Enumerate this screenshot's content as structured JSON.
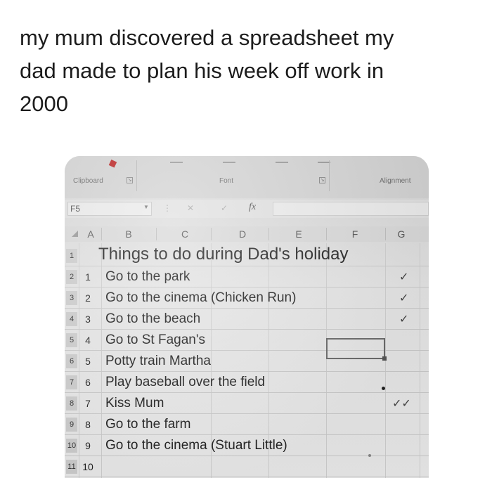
{
  "caption": "my mum discovered a spreadsheet my\ndad made to plan his week off work in\n2000",
  "ribbon": {
    "clipboard_label": "Clipboard",
    "font_label": "Font",
    "alignment_label": "Alignment"
  },
  "formula_bar": {
    "name_box": "F5",
    "fx_label": "fx",
    "formula": ""
  },
  "columns": [
    "A",
    "B",
    "C",
    "D",
    "E",
    "F",
    "G"
  ],
  "title": "Things to do during Dad's holiday",
  "rows": [
    {
      "row": "1",
      "num": "",
      "task": ""
    },
    {
      "row": "2",
      "num": "1",
      "task": "Go to the park",
      "check": "✓"
    },
    {
      "row": "3",
      "num": "2",
      "task": "Go to the cinema (Chicken Run)",
      "check": "✓"
    },
    {
      "row": "4",
      "num": "3",
      "task": "Go to the beach",
      "check": "✓"
    },
    {
      "row": "5",
      "num": "4",
      "task": "Go to St Fagan's",
      "check": ""
    },
    {
      "row": "6",
      "num": "5",
      "task": "Potty train Martha",
      "check": ""
    },
    {
      "row": "7",
      "num": "6",
      "task": "Play baseball over the field",
      "check": ""
    },
    {
      "row": "8",
      "num": "7",
      "task": "Kiss Mum",
      "check": "✓✓"
    },
    {
      "row": "9",
      "num": "8",
      "task": "Go to the farm",
      "check": ""
    },
    {
      "row": "10",
      "num": "9",
      "task": "Go to the cinema (Stuart Little)",
      "check": ""
    },
    {
      "row": "11",
      "num": "10",
      "task": "",
      "check": ""
    }
  ],
  "colors": {
    "cell_text": "#1e1e1e",
    "gridline": "#cbcbcb",
    "ribbon_bg": "#d4d4d4"
  }
}
